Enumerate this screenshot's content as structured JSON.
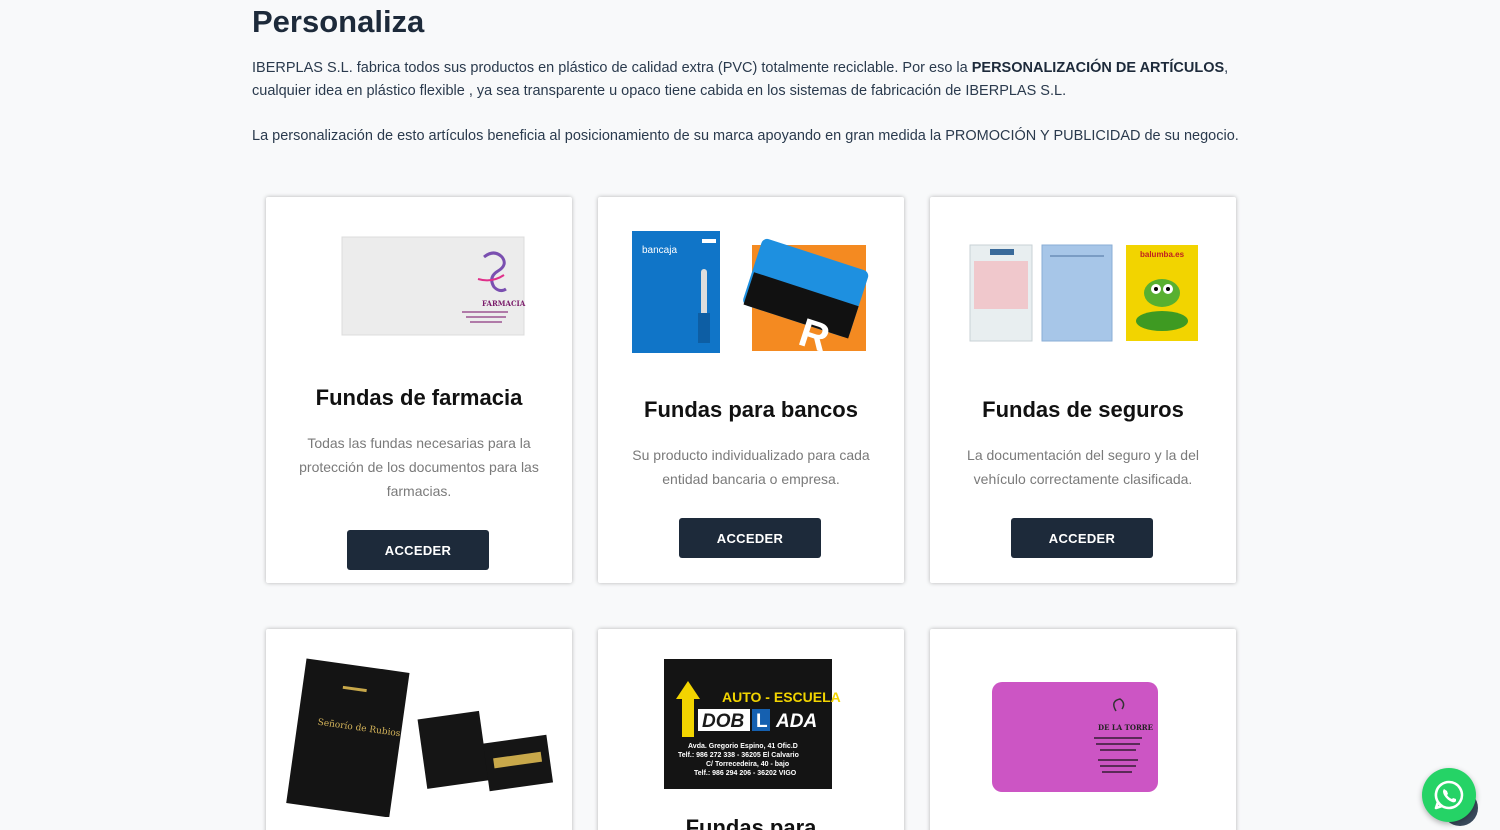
{
  "header": {
    "title": "Personaliza",
    "intro_part1": "IBERPLAS S.L. fabrica todos sus productos en plástico de calidad extra (PVC) totalmente reciclable. Por eso la ",
    "intro_bold": "PERSONALIZACIÓN DE ARTÍCULOS",
    "intro_part2": ", cualquier idea en plástico flexible , ya sea transparente u opaco tiene cabida en los sistemas de fabricación de IBERPLAS S.L.",
    "intro2": "La personalización de esto artículos beneficia al posicionamiento de  su marca apoyando en gran medida la PROMOCIÓN Y PUBLICIDAD de su negocio."
  },
  "cards": [
    {
      "title": "Fundas de farmacia",
      "description": "Todas las fundas necesarias para la protección de los documentos para las farmacias.",
      "button": "ACCEDER",
      "image_text": "FARMACIA"
    },
    {
      "title": "Fundas para bancos",
      "description": "Su producto individualizado para cada entidad bancaria o empresa.",
      "button": "ACCEDER",
      "image_text": "bancaja"
    },
    {
      "title": "Fundas de seguros",
      "description": "La documentación del seguro y la del vehículo correctamente clasificada.",
      "button": "ACCEDER",
      "image_text": "balumba.es"
    },
    {
      "title": "",
      "description": "",
      "button": "",
      "image_text": "Señorío de Rubios"
    },
    {
      "title": "Fundas para",
      "description": "",
      "button": "",
      "image_text": "AUTO - ESCUELA",
      "image_brand_a": "DOB",
      "image_brand_b": "L",
      "image_brand_c": "ADA",
      "image_address_1": "Avda. Gregorio Espino, 41 Ofic.D",
      "image_address_2": "Telf.: 986 272 338 - 36205 El Calvario",
      "image_address_3": "C/ Torrecedeira, 40 - bajo",
      "image_address_4": "Telf.: 986 294 206 - 36202 VIGO"
    },
    {
      "title": "",
      "description": "",
      "button": "",
      "image_text": "DE LA TORRE"
    }
  ],
  "colors": {
    "dark": "#1d2a3a",
    "whatsapp": "#25d366",
    "bank_blue": "#1075c8",
    "bank_orange": "#f48a21",
    "pink": "#cc55c4"
  },
  "icons": {
    "whatsapp": "whatsapp-icon"
  }
}
